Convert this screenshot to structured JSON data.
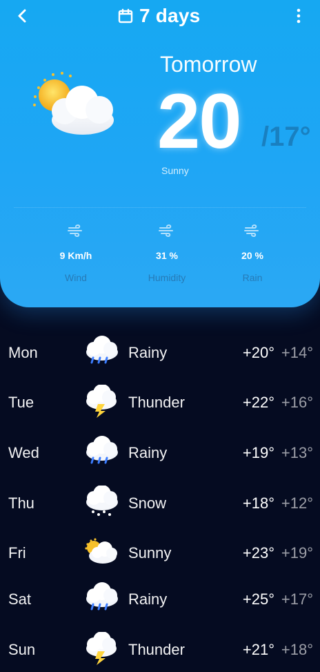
{
  "header": {
    "title": "7 days",
    "back_icon": "chevron-left-icon",
    "calendar_icon": "calendar-icon",
    "menu_icon": "kebab-menu-icon"
  },
  "hero": {
    "label": "Tomorrow",
    "temperature": "20",
    "low_temperature": "/17°",
    "condition": "Sunny",
    "icon": "partly-sunny-icon"
  },
  "stats": [
    {
      "value": "9 Km/h",
      "label": "Wind",
      "icon": "wind-icon"
    },
    {
      "value": "31 %",
      "label": "Humidity",
      "icon": "wind-icon"
    },
    {
      "value": "20 %",
      "label": "Rain",
      "icon": "wind-icon"
    }
  ],
  "forecast": [
    {
      "day": "Mon",
      "condition": "Rainy",
      "high": "+20°",
      "low": "+14°",
      "icon": "rainy-cloud-icon"
    },
    {
      "day": "Tue",
      "condition": "Thunder",
      "high": "+22°",
      "low": "+16°",
      "icon": "thunder-cloud-icon"
    },
    {
      "day": "Wed",
      "condition": "Rainy",
      "high": "+19°",
      "low": "+13°",
      "icon": "rainy-cloud-icon"
    },
    {
      "day": "Thu",
      "condition": "Snow",
      "high": "+18°",
      "low": "+12°",
      "icon": "snow-cloud-icon"
    },
    {
      "day": "Fri",
      "condition": "Sunny",
      "high": "+23°",
      "low": "+19°",
      "icon": "sunny-cloud-icon"
    },
    {
      "day": "Sat",
      "condition": "Rainy",
      "high": "+25°",
      "low": "+17°",
      "icon": "rainy-cloud-icon"
    },
    {
      "day": "Sun",
      "condition": "Thunder",
      "high": "+21°",
      "low": "+18°",
      "icon": "thunder-cloud-icon"
    }
  ],
  "colors": {
    "background": "#050B21",
    "hero_blue": "#1FA6F5",
    "hero_text": "#FFFFFF",
    "muted_text": "#245584",
    "sun": "#F7C12B",
    "cloud": "#F5F7FB",
    "rain": "#3B7CFF",
    "lightning": "#FFD53D"
  }
}
